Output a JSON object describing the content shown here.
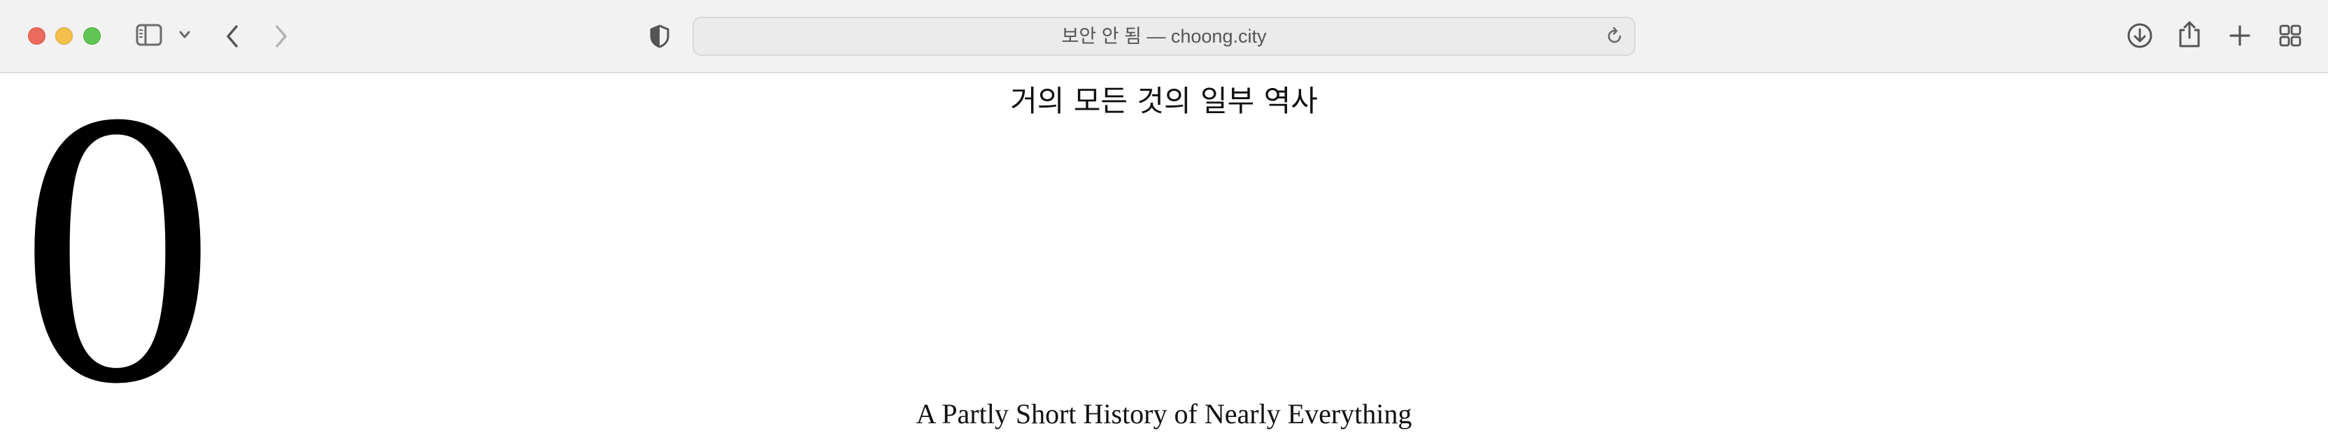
{
  "browser": {
    "address_text": "보안 안 됨 — choong.city",
    "traffic_colors": {
      "close": "#ec6a5e",
      "minimize": "#f4bf4f",
      "maximize": "#61c554"
    },
    "toolbar_icons": [
      "sidebar-toggle-icon",
      "chevron-down-icon",
      "back-arrow-icon",
      "forward-arrow-icon",
      "privacy-shield-icon",
      "reload-icon",
      "download-icon",
      "share-icon",
      "new-tab-plus-icon",
      "tab-overview-icon"
    ]
  },
  "page": {
    "title_korean": "거의 모든 것의 일부 역사",
    "big_numeral": "0",
    "subtitle_english": "A Partly Short History of Nearly Everything"
  }
}
